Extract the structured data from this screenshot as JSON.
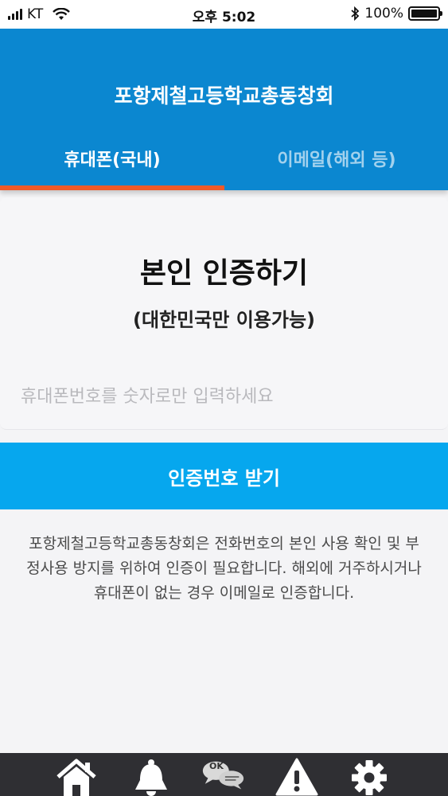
{
  "status_bar": {
    "carrier": "KT",
    "time": "오후 5:02",
    "battery": "100%",
    "battery_level": 1.0
  },
  "header": {
    "title": "포항제철고등학교총동창회",
    "tabs": [
      {
        "label": "휴대폰(국내)",
        "selected": true
      },
      {
        "label": "이메일(해외 등)",
        "selected": false
      }
    ],
    "indicator_color": "#f05a28",
    "background": "#0b87d0"
  },
  "main": {
    "title": "본인 인증하기",
    "subtitle": "(대한민국만 이용가능)",
    "phone_input": {
      "value": "",
      "placeholder": "휴대폰번호를 숫자로만 입력하세요"
    },
    "submit_label": "인증번호 받기",
    "submit_color": "#06a7ee"
  },
  "notice": {
    "text": "포항제철고등학교총동창회은 전화번호의 본인 사용 확인 및 부정사용 방지를 위하여 인증이 필요합니다. 해외에 거주하시거나 휴대폰이 없는 경우 이메일로 인증합니다."
  },
  "bottom_nav": {
    "items": [
      {
        "icon": "home-icon"
      },
      {
        "icon": "bell-icon"
      },
      {
        "icon": "chat-icon",
        "badge": "OK"
      },
      {
        "icon": "warning-icon"
      },
      {
        "icon": "gear-icon"
      }
    ]
  }
}
